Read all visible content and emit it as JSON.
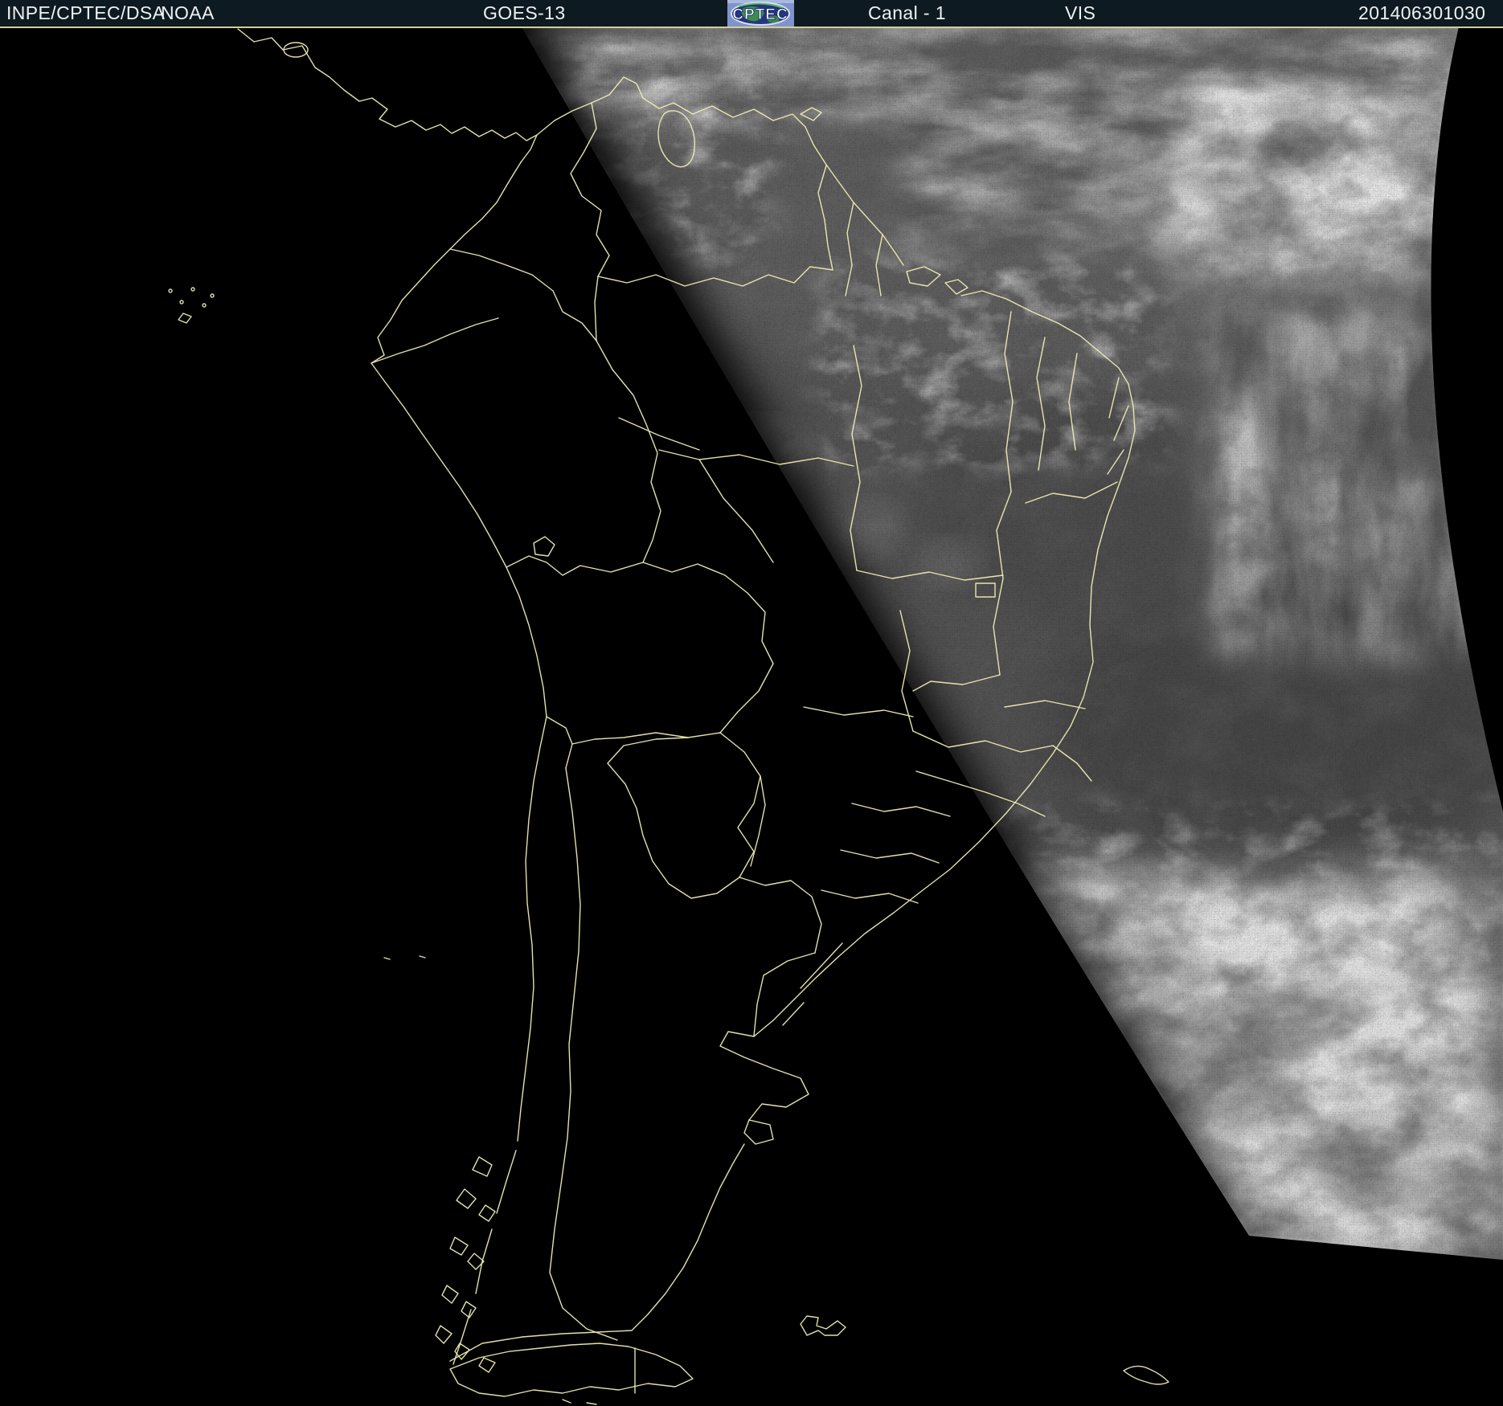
{
  "header": {
    "source": "INPE/CPTEC/DSA",
    "agency": "NOAA",
    "satellite": "GOES-13",
    "logo_text": "CPTEC",
    "channel_label": "Canal - 1",
    "band": "VIS",
    "timestamp": "201406301030"
  },
  "map": {
    "alt": "GOES-13 visible channel satellite image of South America at sunrise with yellow country and state outlines"
  },
  "colors": {
    "header_bg": "#0e1a22",
    "header_text": "#eef2f2",
    "map_border_line": "#e9e5a6",
    "geo_outline": "#f0ecb4",
    "night": "#000000",
    "day_base": "#585858",
    "cloud_bright": "#e8e8e8",
    "logo_bg": "#7f93cc",
    "logo_globe": "#24367e",
    "logo_land": "#3f9e43"
  }
}
